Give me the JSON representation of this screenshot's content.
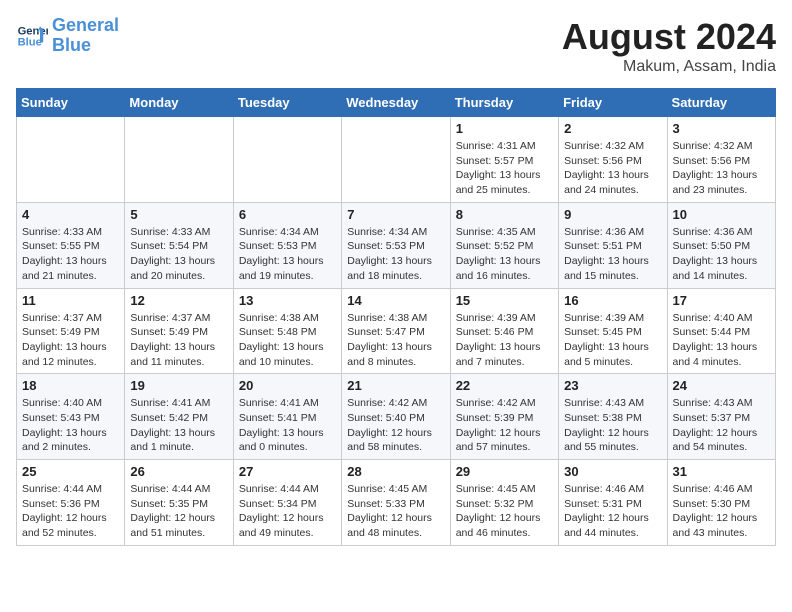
{
  "header": {
    "logo_line1": "General",
    "logo_line2": "Blue",
    "month_year": "August 2024",
    "location": "Makum, Assam, India"
  },
  "weekdays": [
    "Sunday",
    "Monday",
    "Tuesday",
    "Wednesday",
    "Thursday",
    "Friday",
    "Saturday"
  ],
  "weeks": [
    [
      {
        "day": "",
        "sunrise": "",
        "sunset": "",
        "daylight": ""
      },
      {
        "day": "",
        "sunrise": "",
        "sunset": "",
        "daylight": ""
      },
      {
        "day": "",
        "sunrise": "",
        "sunset": "",
        "daylight": ""
      },
      {
        "day": "",
        "sunrise": "",
        "sunset": "",
        "daylight": ""
      },
      {
        "day": "1",
        "sunrise": "Sunrise: 4:31 AM",
        "sunset": "Sunset: 5:57 PM",
        "daylight": "Daylight: 13 hours and 25 minutes."
      },
      {
        "day": "2",
        "sunrise": "Sunrise: 4:32 AM",
        "sunset": "Sunset: 5:56 PM",
        "daylight": "Daylight: 13 hours and 24 minutes."
      },
      {
        "day": "3",
        "sunrise": "Sunrise: 4:32 AM",
        "sunset": "Sunset: 5:56 PM",
        "daylight": "Daylight: 13 hours and 23 minutes."
      }
    ],
    [
      {
        "day": "4",
        "sunrise": "Sunrise: 4:33 AM",
        "sunset": "Sunset: 5:55 PM",
        "daylight": "Daylight: 13 hours and 21 minutes."
      },
      {
        "day": "5",
        "sunrise": "Sunrise: 4:33 AM",
        "sunset": "Sunset: 5:54 PM",
        "daylight": "Daylight: 13 hours and 20 minutes."
      },
      {
        "day": "6",
        "sunrise": "Sunrise: 4:34 AM",
        "sunset": "Sunset: 5:53 PM",
        "daylight": "Daylight: 13 hours and 19 minutes."
      },
      {
        "day": "7",
        "sunrise": "Sunrise: 4:34 AM",
        "sunset": "Sunset: 5:53 PM",
        "daylight": "Daylight: 13 hours and 18 minutes."
      },
      {
        "day": "8",
        "sunrise": "Sunrise: 4:35 AM",
        "sunset": "Sunset: 5:52 PM",
        "daylight": "Daylight: 13 hours and 16 minutes."
      },
      {
        "day": "9",
        "sunrise": "Sunrise: 4:36 AM",
        "sunset": "Sunset: 5:51 PM",
        "daylight": "Daylight: 13 hours and 15 minutes."
      },
      {
        "day": "10",
        "sunrise": "Sunrise: 4:36 AM",
        "sunset": "Sunset: 5:50 PM",
        "daylight": "Daylight: 13 hours and 14 minutes."
      }
    ],
    [
      {
        "day": "11",
        "sunrise": "Sunrise: 4:37 AM",
        "sunset": "Sunset: 5:49 PM",
        "daylight": "Daylight: 13 hours and 12 minutes."
      },
      {
        "day": "12",
        "sunrise": "Sunrise: 4:37 AM",
        "sunset": "Sunset: 5:49 PM",
        "daylight": "Daylight: 13 hours and 11 minutes."
      },
      {
        "day": "13",
        "sunrise": "Sunrise: 4:38 AM",
        "sunset": "Sunset: 5:48 PM",
        "daylight": "Daylight: 13 hours and 10 minutes."
      },
      {
        "day": "14",
        "sunrise": "Sunrise: 4:38 AM",
        "sunset": "Sunset: 5:47 PM",
        "daylight": "Daylight: 13 hours and 8 minutes."
      },
      {
        "day": "15",
        "sunrise": "Sunrise: 4:39 AM",
        "sunset": "Sunset: 5:46 PM",
        "daylight": "Daylight: 13 hours and 7 minutes."
      },
      {
        "day": "16",
        "sunrise": "Sunrise: 4:39 AM",
        "sunset": "Sunset: 5:45 PM",
        "daylight": "Daylight: 13 hours and 5 minutes."
      },
      {
        "day": "17",
        "sunrise": "Sunrise: 4:40 AM",
        "sunset": "Sunset: 5:44 PM",
        "daylight": "Daylight: 13 hours and 4 minutes."
      }
    ],
    [
      {
        "day": "18",
        "sunrise": "Sunrise: 4:40 AM",
        "sunset": "Sunset: 5:43 PM",
        "daylight": "Daylight: 13 hours and 2 minutes."
      },
      {
        "day": "19",
        "sunrise": "Sunrise: 4:41 AM",
        "sunset": "Sunset: 5:42 PM",
        "daylight": "Daylight: 13 hours and 1 minute."
      },
      {
        "day": "20",
        "sunrise": "Sunrise: 4:41 AM",
        "sunset": "Sunset: 5:41 PM",
        "daylight": "Daylight: 13 hours and 0 minutes."
      },
      {
        "day": "21",
        "sunrise": "Sunrise: 4:42 AM",
        "sunset": "Sunset: 5:40 PM",
        "daylight": "Daylight: 12 hours and 58 minutes."
      },
      {
        "day": "22",
        "sunrise": "Sunrise: 4:42 AM",
        "sunset": "Sunset: 5:39 PM",
        "daylight": "Daylight: 12 hours and 57 minutes."
      },
      {
        "day": "23",
        "sunrise": "Sunrise: 4:43 AM",
        "sunset": "Sunset: 5:38 PM",
        "daylight": "Daylight: 12 hours and 55 minutes."
      },
      {
        "day": "24",
        "sunrise": "Sunrise: 4:43 AM",
        "sunset": "Sunset: 5:37 PM",
        "daylight": "Daylight: 12 hours and 54 minutes."
      }
    ],
    [
      {
        "day": "25",
        "sunrise": "Sunrise: 4:44 AM",
        "sunset": "Sunset: 5:36 PM",
        "daylight": "Daylight: 12 hours and 52 minutes."
      },
      {
        "day": "26",
        "sunrise": "Sunrise: 4:44 AM",
        "sunset": "Sunset: 5:35 PM",
        "daylight": "Daylight: 12 hours and 51 minutes."
      },
      {
        "day": "27",
        "sunrise": "Sunrise: 4:44 AM",
        "sunset": "Sunset: 5:34 PM",
        "daylight": "Daylight: 12 hours and 49 minutes."
      },
      {
        "day": "28",
        "sunrise": "Sunrise: 4:45 AM",
        "sunset": "Sunset: 5:33 PM",
        "daylight": "Daylight: 12 hours and 48 minutes."
      },
      {
        "day": "29",
        "sunrise": "Sunrise: 4:45 AM",
        "sunset": "Sunset: 5:32 PM",
        "daylight": "Daylight: 12 hours and 46 minutes."
      },
      {
        "day": "30",
        "sunrise": "Sunrise: 4:46 AM",
        "sunset": "Sunset: 5:31 PM",
        "daylight": "Daylight: 12 hours and 44 minutes."
      },
      {
        "day": "31",
        "sunrise": "Sunrise: 4:46 AM",
        "sunset": "Sunset: 5:30 PM",
        "daylight": "Daylight: 12 hours and 43 minutes."
      }
    ]
  ]
}
